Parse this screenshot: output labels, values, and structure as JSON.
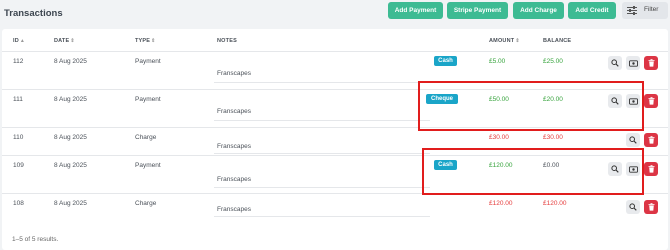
{
  "header": {
    "title": "Transactions",
    "buttons": {
      "add_payment": "Add Payment",
      "stripe_payment": "Stripe Payment",
      "add_charge": "Add Charge",
      "add_credit": "Add Credit",
      "filter": "Filter"
    }
  },
  "table": {
    "columns": {
      "id": "ID",
      "date": "DATE",
      "type": "TYPE",
      "notes": "NOTES",
      "amount": "AMOUNT",
      "balance": "BALANCE"
    },
    "rows": [
      {
        "id": "112",
        "date": "8 Aug 2025",
        "type": "Payment",
        "notes": "Franscapes",
        "badge": "Cash",
        "amount": "£5.00",
        "balance": "£25.00"
      },
      {
        "id": "111",
        "date": "8 Aug 2025",
        "type": "Payment",
        "notes": "Franscapes",
        "badge": "Cheque",
        "amount": "£50.00",
        "balance": "£20.00"
      },
      {
        "id": "110",
        "date": "8 Aug 2025",
        "type": "Charge",
        "notes": "Franscapes",
        "badge": "",
        "amount": "£30.00",
        "balance": "£30.00"
      },
      {
        "id": "109",
        "date": "8 Aug 2025",
        "type": "Payment",
        "notes": "Franscapes",
        "badge": "Cash",
        "amount": "£120.00",
        "balance": "£0.00"
      },
      {
        "id": "108",
        "date": "8 Aug 2025",
        "type": "Charge",
        "notes": "Franscapes",
        "badge": "",
        "amount": "£120.00",
        "balance": "£120.00"
      }
    ]
  },
  "footer": {
    "summary": "1–5 of 5 results."
  },
  "colors": {
    "accent": "#3dbb93",
    "badge": "#1aa5c8",
    "positive": "#36a33c",
    "negative": "#e53b3b",
    "delete": "#dc3545",
    "highlight": "#e11d1d"
  }
}
